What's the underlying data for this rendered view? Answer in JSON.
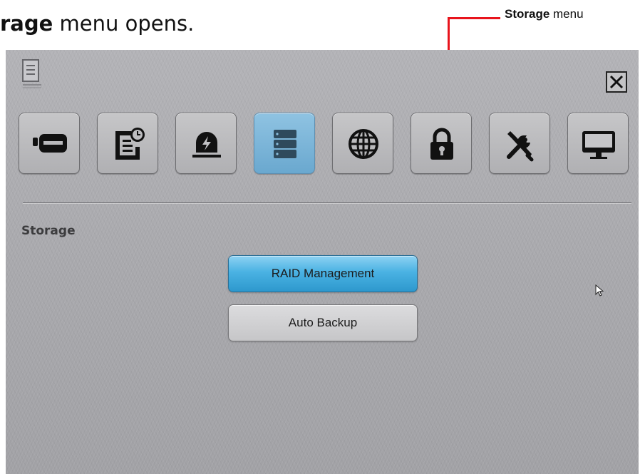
{
  "caption": {
    "bold": "rage",
    "rest": " menu opens."
  },
  "callout": {
    "bold": "Storage",
    "rest": " menu"
  },
  "panel": {
    "doc_icon": "document-icon",
    "close_icon": "close-icon",
    "tabs": [
      {
        "id": "recording-device",
        "icon": "hdd-device-icon",
        "active": false
      },
      {
        "id": "schedule",
        "icon": "schedule-icon",
        "active": false
      },
      {
        "id": "alarm",
        "icon": "alarm-icon",
        "active": false
      },
      {
        "id": "storage",
        "icon": "storage-icon",
        "active": true
      },
      {
        "id": "network",
        "icon": "globe-icon",
        "active": false
      },
      {
        "id": "security",
        "icon": "lock-icon",
        "active": false
      },
      {
        "id": "tools",
        "icon": "tools-icon",
        "active": false
      },
      {
        "id": "display",
        "icon": "monitor-icon",
        "active": false
      }
    ],
    "section_title": "Storage",
    "buttons": {
      "raid": "RAID Management",
      "backup": "Auto Backup"
    }
  },
  "colors": {
    "accent": "#e8141c",
    "active_tab": "#7ab6da",
    "primary_button": "#4ab2e3"
  }
}
